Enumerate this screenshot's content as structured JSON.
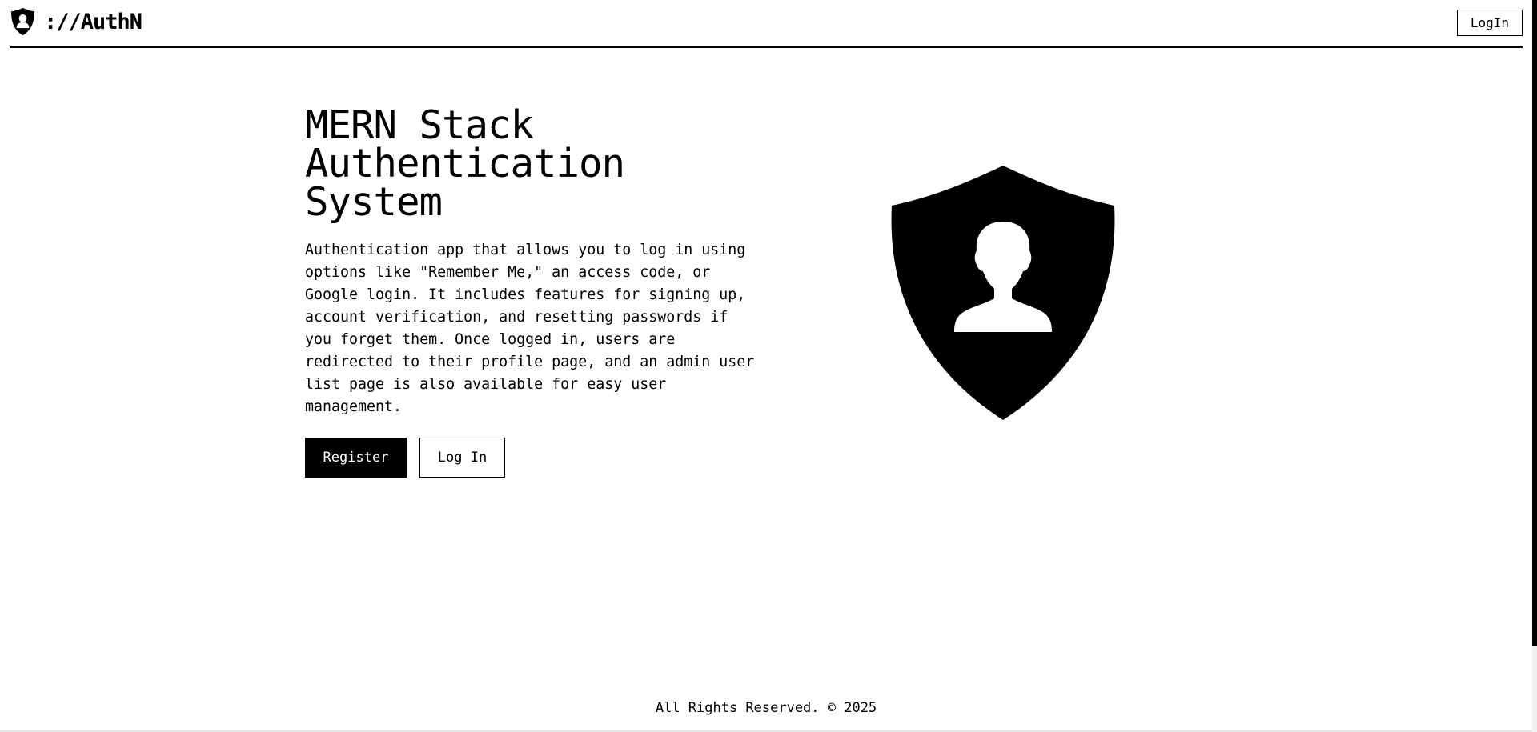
{
  "navbar": {
    "brand_text": "://AuthN",
    "brand_icon": "shield-user-icon",
    "login_label": "LogIn"
  },
  "hero": {
    "title": "MERN Stack Authentication System",
    "description": "Authentication app that allows you to log in using options like \"Remember Me,\" an access code, or Google login. It includes features for signing up, account verification, and resetting passwords if you forget them. Once logged in, users are redirected to their profile page, and an admin user list page is also available for easy user management.",
    "register_label": "Register",
    "login_label": "Log In",
    "illustration_icon": "shield-user-icon"
  },
  "footer": {
    "text": "All Rights Reserved. © 2025"
  },
  "colors": {
    "primary": "#000000",
    "background": "#ffffff"
  }
}
